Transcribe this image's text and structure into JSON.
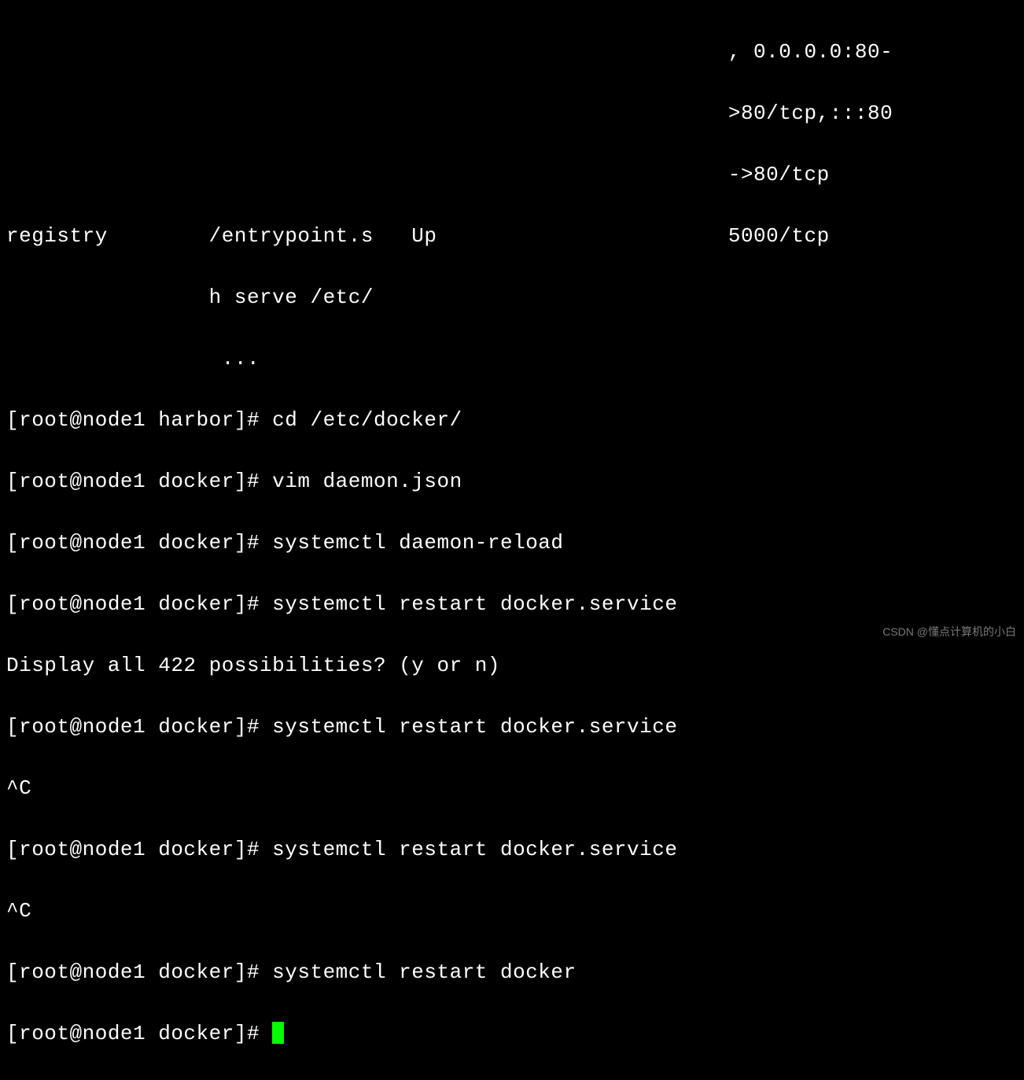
{
  "terminal": {
    "header": {
      "ports_line1": "                                                         , 0.0.0.0:80-",
      "ports_line2": "                                                         >80/tcp,:::80",
      "ports_line3": "                                                         ->80/tcp",
      "registry_line1": "registry        /entrypoint.s   Up                       5000/tcp",
      "registry_line2": "                h serve /etc/",
      "registry_line3": "                 ..."
    },
    "lines": [
      {
        "prompt": "[root@node1 harbor]# ",
        "command": "cd /etc/docker/"
      },
      {
        "prompt": "[root@node1 docker]# ",
        "command": "vim daemon.json"
      },
      {
        "prompt": "[root@node1 docker]# ",
        "command": "systemctl daemon-reload"
      },
      {
        "prompt": "[root@node1 docker]# ",
        "command": "systemctl restart docker.service"
      },
      {
        "prompt": "",
        "command": "Display all 422 possibilities? (y or n)"
      },
      {
        "prompt": "[root@node1 docker]# ",
        "command": "systemctl restart docker.service"
      },
      {
        "prompt": "",
        "command": "^C"
      },
      {
        "prompt": "[root@node1 docker]# ",
        "command": "systemctl restart docker.service"
      },
      {
        "prompt": "",
        "command": "^C"
      },
      {
        "prompt": "[root@node1 docker]# ",
        "command": "systemctl restart docker"
      },
      {
        "prompt": "[root@node1 docker]# ",
        "command": ""
      }
    ]
  },
  "watermark": "CSDN @懂点计算机的小白"
}
